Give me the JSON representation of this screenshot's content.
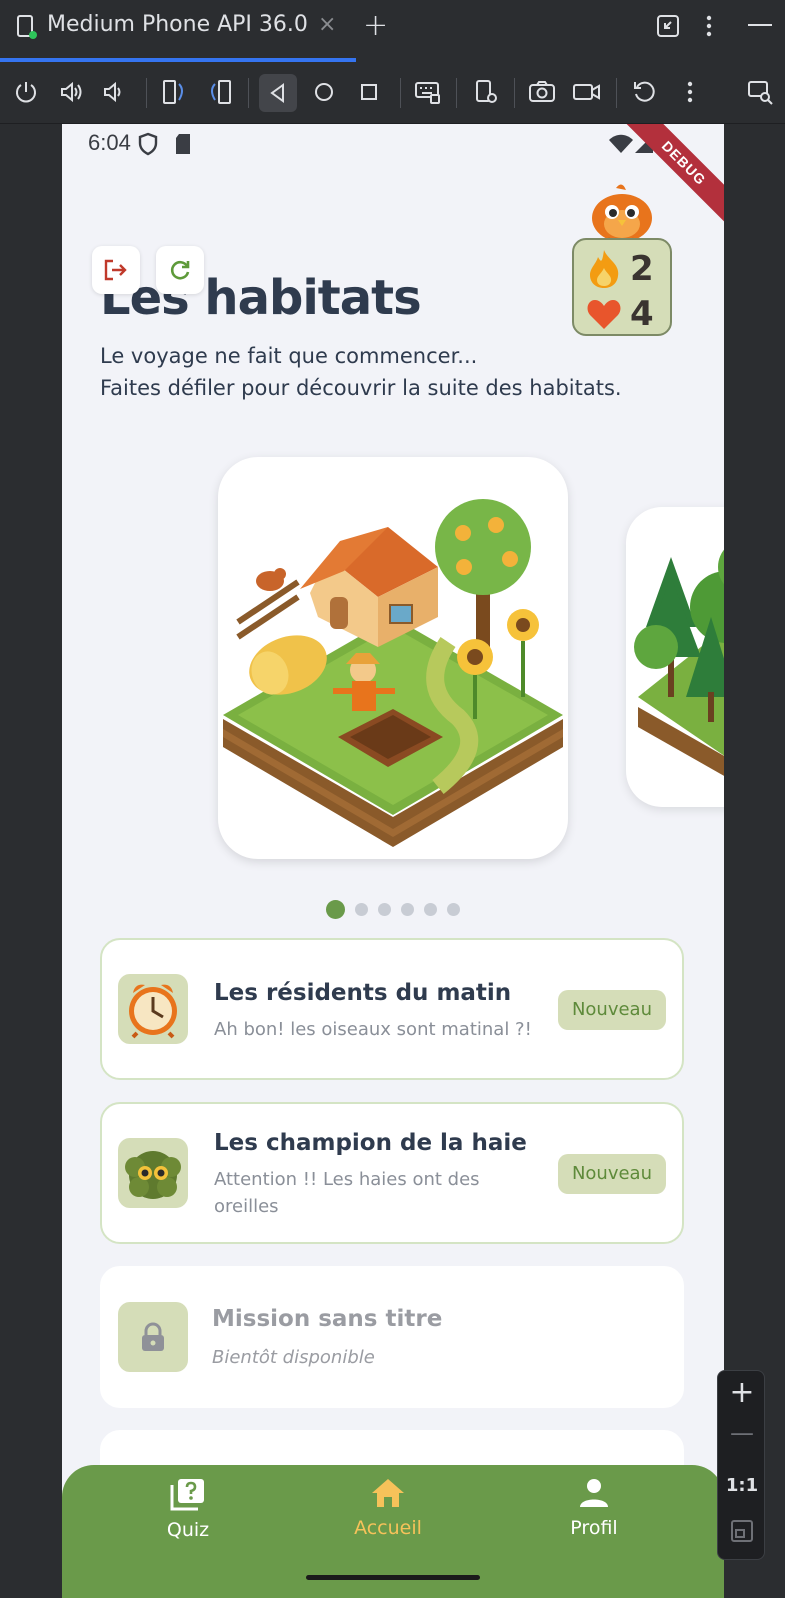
{
  "emulator": {
    "tab_title": "Medium Phone API 36.0",
    "tab_close": "×",
    "new_tab": "+",
    "zoom_label": "1:1",
    "zoom_in": "+",
    "zoom_out": "—"
  },
  "status_bar": {
    "time": "6:04",
    "debug_label": "DEBUG"
  },
  "header": {
    "title": "Les habitats",
    "subtitle_line1": "Le voyage ne fait que commencer...",
    "subtitle_line2": "Faites défiler pour découvrir la suite des habitats."
  },
  "stats": {
    "streak": "2",
    "lives": "4"
  },
  "carousel": {
    "page_count": 6,
    "active_index": 0
  },
  "missions": [
    {
      "title": "Les résidents du matin",
      "subtitle": "Ah bon! les oiseaux sont matinal ?!",
      "badge": "Nouveau",
      "icon": "alarm-clock-icon"
    },
    {
      "title": "Les champion de la haie",
      "subtitle_line1": "Attention !! Les haies ont des",
      "subtitle_line2": "oreilles",
      "badge": "Nouveau",
      "icon": "owl-hedge-icon"
    },
    {
      "title": "Mission sans titre",
      "subtitle": "Bientôt disponible",
      "icon": "lock-icon"
    }
  ],
  "bottom_nav": {
    "items": [
      {
        "label": "Quiz",
        "icon": "quiz-icon"
      },
      {
        "label": "Accueil",
        "icon": "home-icon"
      },
      {
        "label": "Profil",
        "icon": "profile-icon"
      }
    ]
  },
  "colors": {
    "accent_green": "#6a9a4a",
    "active_nav": "#f6c25a",
    "badge_bg": "#d5ddb8",
    "title_text": "#2f3b4e"
  }
}
